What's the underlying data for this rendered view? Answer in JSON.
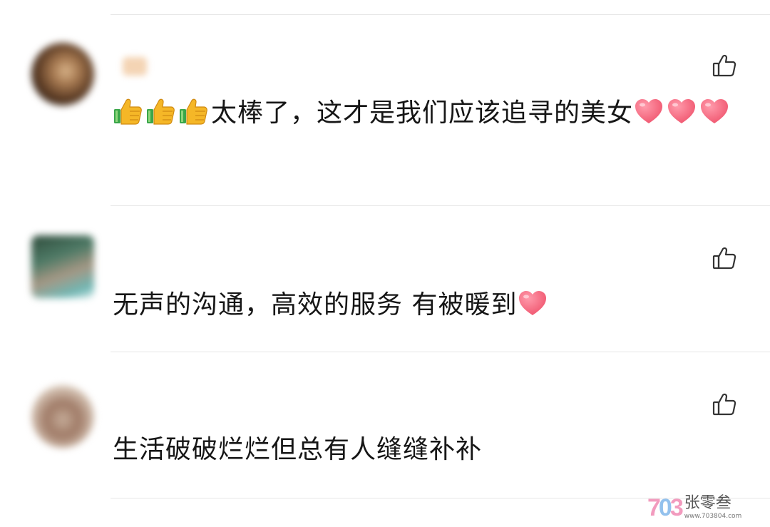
{
  "comments": [
    {
      "user": "",
      "time": "",
      "text": "太棒了，这才是我们应该追寻的美女",
      "emoji_prefix": [
        "thumbs-up",
        "thumbs-up",
        "thumbs-up"
      ],
      "emoji_suffix": [
        "heart",
        "heart",
        "heart"
      ]
    },
    {
      "user": "",
      "time": "",
      "text": "无声的沟通，高效的服务 有被暖到",
      "emoji_prefix": [],
      "emoji_suffix": [
        "heart"
      ]
    },
    {
      "user": "",
      "time": "",
      "text": "生活破破烂烂但总有人缝缝补补",
      "emoji_prefix": [],
      "emoji_suffix": []
    }
  ],
  "icons": {
    "like": "thumbs-up-outline-icon",
    "thumb_emoji": "thumbs-up-emoji-icon",
    "heart_emoji": "heart-emoji-icon"
  },
  "colors": {
    "heart": "#f0566f",
    "thumb": "#f5b727",
    "divider": "#e6e6e6",
    "text": "#161616"
  },
  "watermark": {
    "logo_text": "703",
    "name": "张零叁",
    "url": "www.703804.com"
  }
}
